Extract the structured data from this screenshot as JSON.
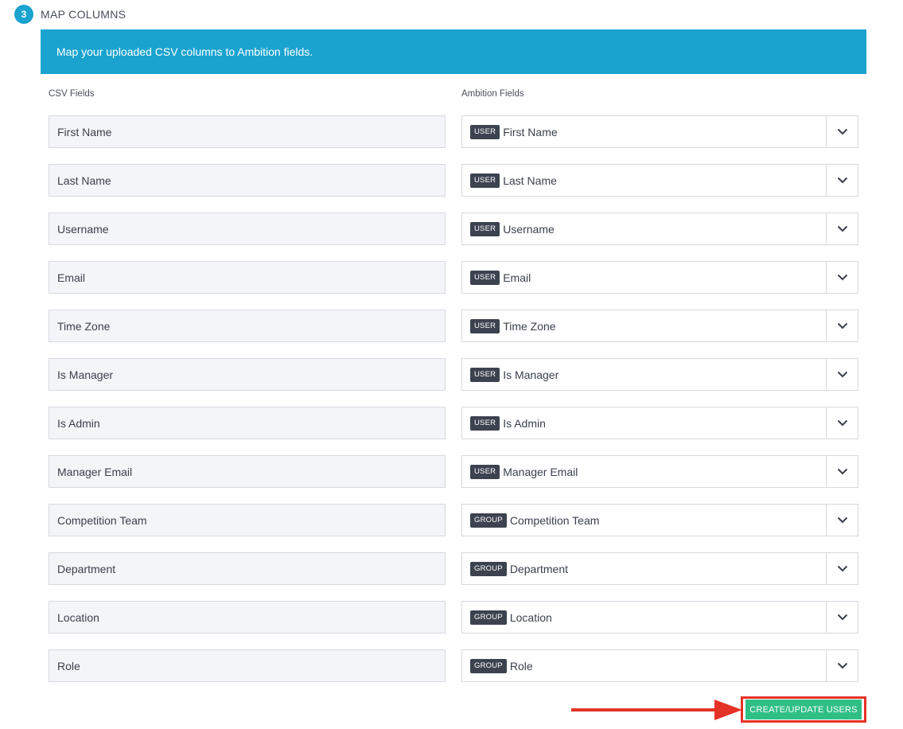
{
  "step": {
    "number": "3",
    "title": "MAP COLUMNS"
  },
  "banner": {
    "text": "Map your uploaded CSV columns to Ambition fields."
  },
  "columns": {
    "csv": "CSV Fields",
    "ambition": "Ambition Fields"
  },
  "mappings": [
    {
      "csv": "First Name",
      "tag": "USER",
      "field": "First Name"
    },
    {
      "csv": "Last Name",
      "tag": "USER",
      "field": "Last Name"
    },
    {
      "csv": "Username",
      "tag": "USER",
      "field": "Username"
    },
    {
      "csv": "Email",
      "tag": "USER",
      "field": "Email"
    },
    {
      "csv": "Time Zone",
      "tag": "USER",
      "field": "Time Zone"
    },
    {
      "csv": "Is Manager",
      "tag": "USER",
      "field": "Is Manager"
    },
    {
      "csv": "Is Admin",
      "tag": "USER",
      "field": "Is Admin"
    },
    {
      "csv": "Manager Email",
      "tag": "USER",
      "field": "Manager Email"
    },
    {
      "csv": "Competition Team",
      "tag": "GROUP",
      "field": "Competition Team"
    },
    {
      "csv": "Department",
      "tag": "GROUP",
      "field": "Department"
    },
    {
      "csv": "Location",
      "tag": "GROUP",
      "field": "Location"
    },
    {
      "csv": "Role",
      "tag": "GROUP",
      "field": "Role"
    }
  ],
  "submit": {
    "label": "CREATE/UPDATE USERS"
  },
  "colors": {
    "accent": "#1aa3cf",
    "submit": "#2fbf85",
    "annotation": "#e53226",
    "tag": "#3d4250"
  }
}
